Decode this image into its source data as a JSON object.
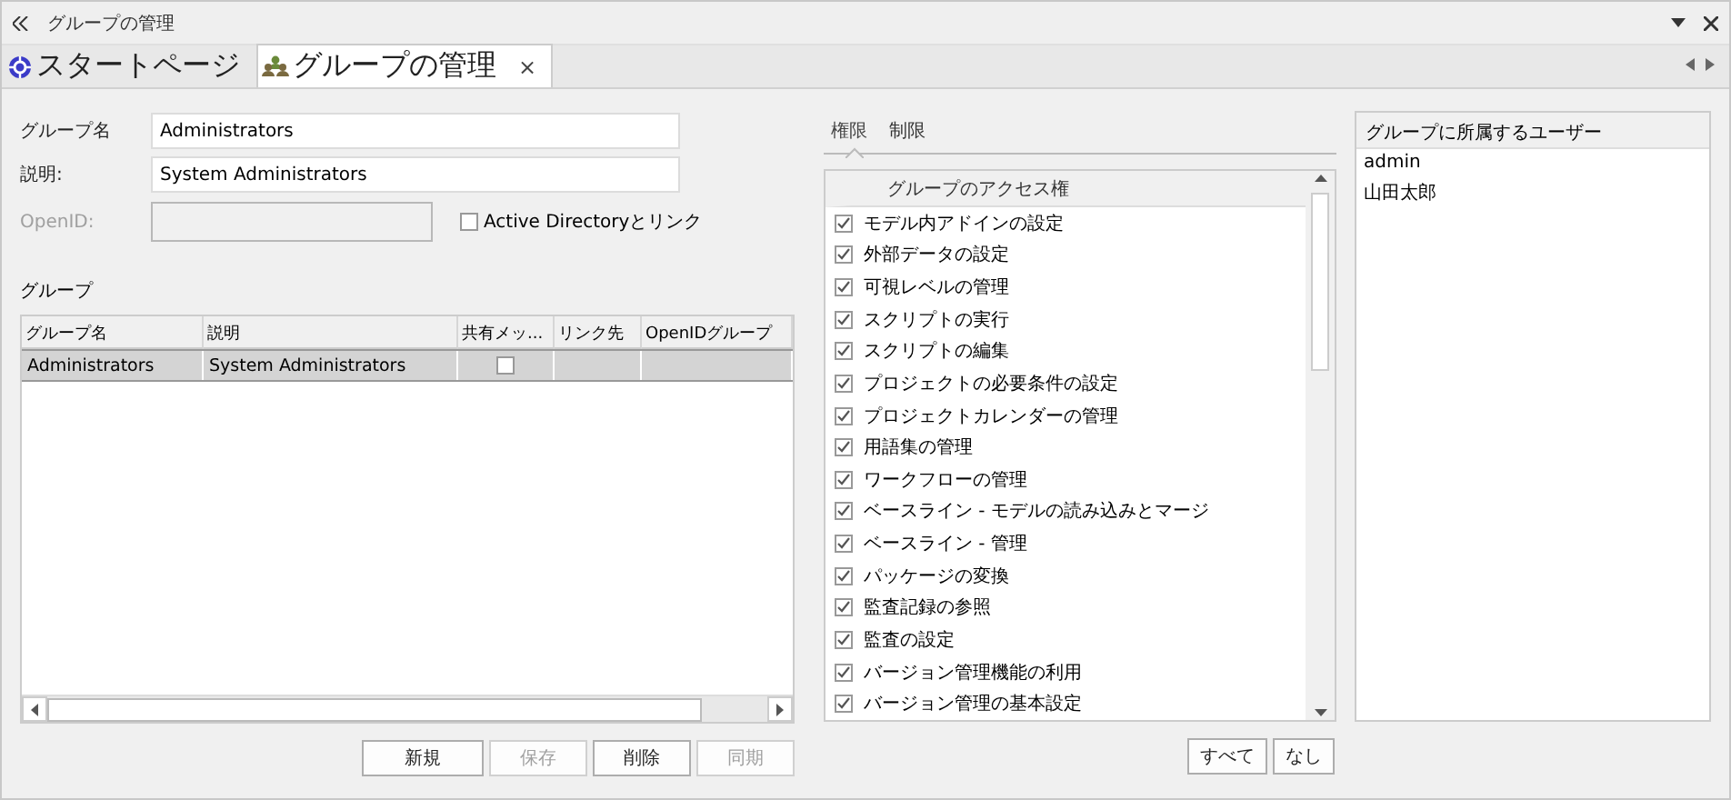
{
  "window": {
    "title": "グループの管理"
  },
  "doc_tabs": [
    {
      "label": "スタートページ",
      "kind": "start",
      "selected": false,
      "closable": false
    },
    {
      "label": "グループの管理",
      "kind": "group",
      "selected": true,
      "closable": true
    }
  ],
  "close_glyph": "×",
  "form": {
    "name_label": "グループ名",
    "name_value": "Administrators",
    "desc_label": "説明:",
    "desc_value": "System Administrators",
    "openid_label": "OpenID:",
    "openid_disabled": true,
    "ad_link": {
      "label": "Active Directoryとリンク",
      "checked": false
    }
  },
  "groups": {
    "title": "グループ",
    "columns": [
      "グループ名",
      "説明",
      "共有メッ...",
      "リンク先",
      "OpenIDグループ"
    ],
    "rows": [
      {
        "name": "Administrators",
        "description": "System Administrators",
        "shared": false,
        "link": "",
        "openid": "",
        "selected": true
      }
    ]
  },
  "group_buttons": [
    {
      "label": "新規",
      "disabled": false
    },
    {
      "label": "保存",
      "disabled": true
    },
    {
      "label": "削除",
      "disabled": false
    },
    {
      "label": "同期",
      "disabled": true
    }
  ],
  "perm_tabs": [
    {
      "label": "権限",
      "selected": true
    },
    {
      "label": "制限",
      "selected": false
    }
  ],
  "permissions": {
    "header": "グループのアクセス権",
    "items": [
      {
        "label": "モデル内アドインの設定",
        "checked": true
      },
      {
        "label": "外部データの設定",
        "checked": true
      },
      {
        "label": "可視レベルの管理",
        "checked": true
      },
      {
        "label": "スクリプトの実行",
        "checked": true
      },
      {
        "label": "スクリプトの編集",
        "checked": true
      },
      {
        "label": "プロジェクトの必要条件の設定",
        "checked": true
      },
      {
        "label": "プロジェクトカレンダーの管理",
        "checked": true
      },
      {
        "label": "用語集の管理",
        "checked": true
      },
      {
        "label": "ワークフローの管理",
        "checked": true
      },
      {
        "label": "ベースライン - モデルの読み込みとマージ",
        "checked": true
      },
      {
        "label": "ベースライン - 管理",
        "checked": true
      },
      {
        "label": "パッケージの変換",
        "checked": true
      },
      {
        "label": "監査記録の参照",
        "checked": true
      },
      {
        "label": "監査の設定",
        "checked": true
      },
      {
        "label": "バージョン管理機能の利用",
        "checked": true
      },
      {
        "label": "バージョン管理の基本設定",
        "checked": true
      }
    ]
  },
  "perm_buttons": [
    {
      "label": "すべて"
    },
    {
      "label": "なし"
    }
  ],
  "members": {
    "header": "グループに所属するユーザー",
    "items": [
      "admin",
      "山田太郎"
    ]
  }
}
